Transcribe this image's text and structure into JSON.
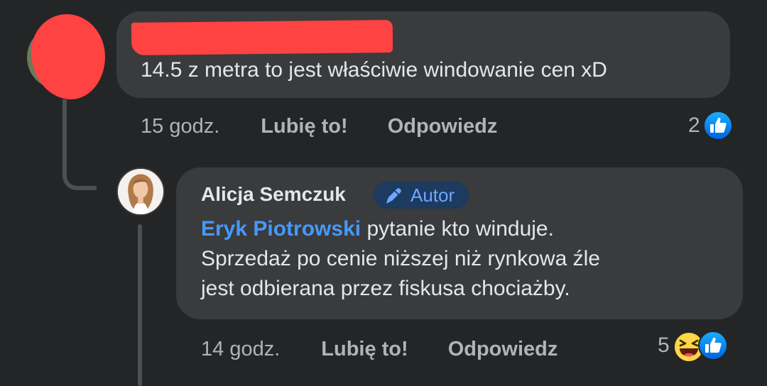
{
  "comments": [
    {
      "author_name": "",
      "text": "14.5 z metra to jest właściwie windowanie cen xD",
      "timestamp": "15 godz.",
      "like_label": "Lubię to!",
      "reply_label": "Odpowiedz",
      "reaction_count": "2",
      "reactions": [
        "like-icon"
      ]
    },
    {
      "author_name": "Alicja Semczuk",
      "badge_label": "Autor",
      "badge_icon": "pencil-icon",
      "mention": "Eryk Piotrowski",
      "text_line_1": "pytanie kto winduje.",
      "text_line_2": "Sprzedaż po cenie niższej niż rynkowa źle",
      "text_line_3": "jest odbierana przez fiskusa chociażby.",
      "timestamp": "14 godz.",
      "like_label": "Lubię to!",
      "reply_label": "Odpowiedz",
      "reaction_count": "5",
      "reactions": [
        "haha-icon",
        "like-icon"
      ]
    }
  ],
  "colors": {
    "background": "#242526",
    "bubble": "#3a3b3c",
    "text_primary": "#e4e6eb",
    "text_secondary": "#b0b3b8",
    "mention": "#4599ff",
    "like_blue": "#1877f2",
    "redaction_red": "#ff4242"
  }
}
